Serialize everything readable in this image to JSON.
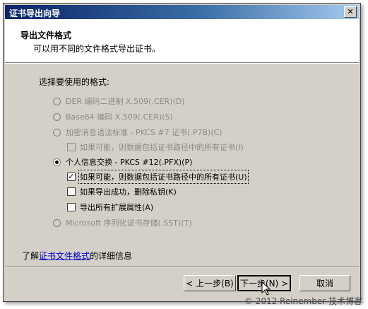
{
  "window": {
    "title": "证书导出向导",
    "close_glyph": "✕"
  },
  "header": {
    "title": "导出文件格式",
    "subtitle": "可以用不同的文件格式导出证书。"
  },
  "prompt": "选择要使用的格式:",
  "options": {
    "der": "DER 编码二进制 X.509(.CER)(D)",
    "base64": "Base64 编码 X.509(.CER)(S)",
    "pkcs7": "加密消息语法标准 - PKCS #7 证书(.P7B)(C)",
    "pkcs7_include": "如果可能，则数据包括证书路径中的所有证书(I)",
    "pkcs12": "个人信息交换 - PKCS #12(.PFX)(P)",
    "pkcs12_include": "如果可能，则数据包括证书路径中的所有证书(U)",
    "pkcs12_delete": "如果导出成功，删除私钥(K)",
    "pkcs12_export_ext": "导出所有扩展属性(A)",
    "sst": "Microsoft 序列化证书存储(.SST)(T)"
  },
  "check_glyph": "✓",
  "more_info": {
    "prefix": "了解",
    "link": "证书文件格式",
    "suffix": "的详细信息"
  },
  "buttons": {
    "back": "< 上一步(B)",
    "next": "下一步(N) >",
    "cancel": "取消"
  },
  "watermark": "© 2012 Reinember 技术博客"
}
